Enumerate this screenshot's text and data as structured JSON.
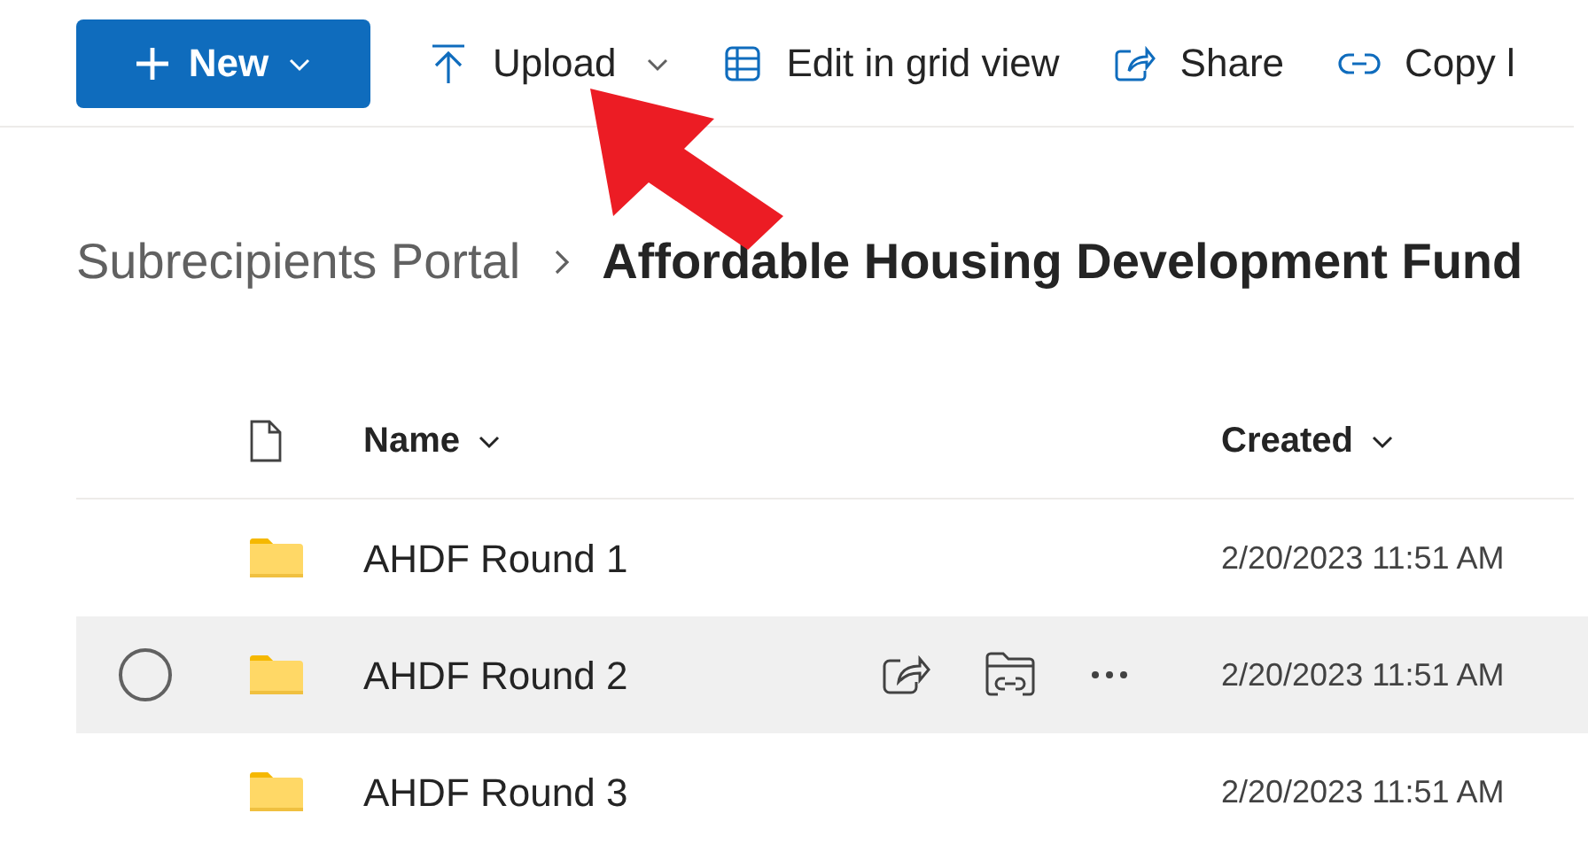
{
  "toolbar": [
    {
      "kind": "new",
      "label": "New"
    },
    {
      "kind": "upload",
      "label": "Upload"
    },
    {
      "kind": "grid",
      "label": "Edit in grid view"
    },
    {
      "kind": "share",
      "label": "Share"
    },
    {
      "kind": "link",
      "label": "Copy l"
    }
  ],
  "breadcrumb": [
    {
      "label": "Subrecipients Portal",
      "current": false
    },
    {
      "label": "Affordable Housing Development Fund",
      "current": true
    }
  ],
  "columns": [
    "Name",
    "Created"
  ],
  "rows": [
    {
      "name": "AHDF Round 1",
      "created": "2/20/2023 11:51 AM",
      "hovered": false
    },
    {
      "name": "AHDF Round 2",
      "created": "2/20/2023 11:51 AM",
      "hovered": true
    },
    {
      "name": "AHDF Round 3",
      "created": "2/20/2023 11:51 AM",
      "hovered": false
    }
  ]
}
